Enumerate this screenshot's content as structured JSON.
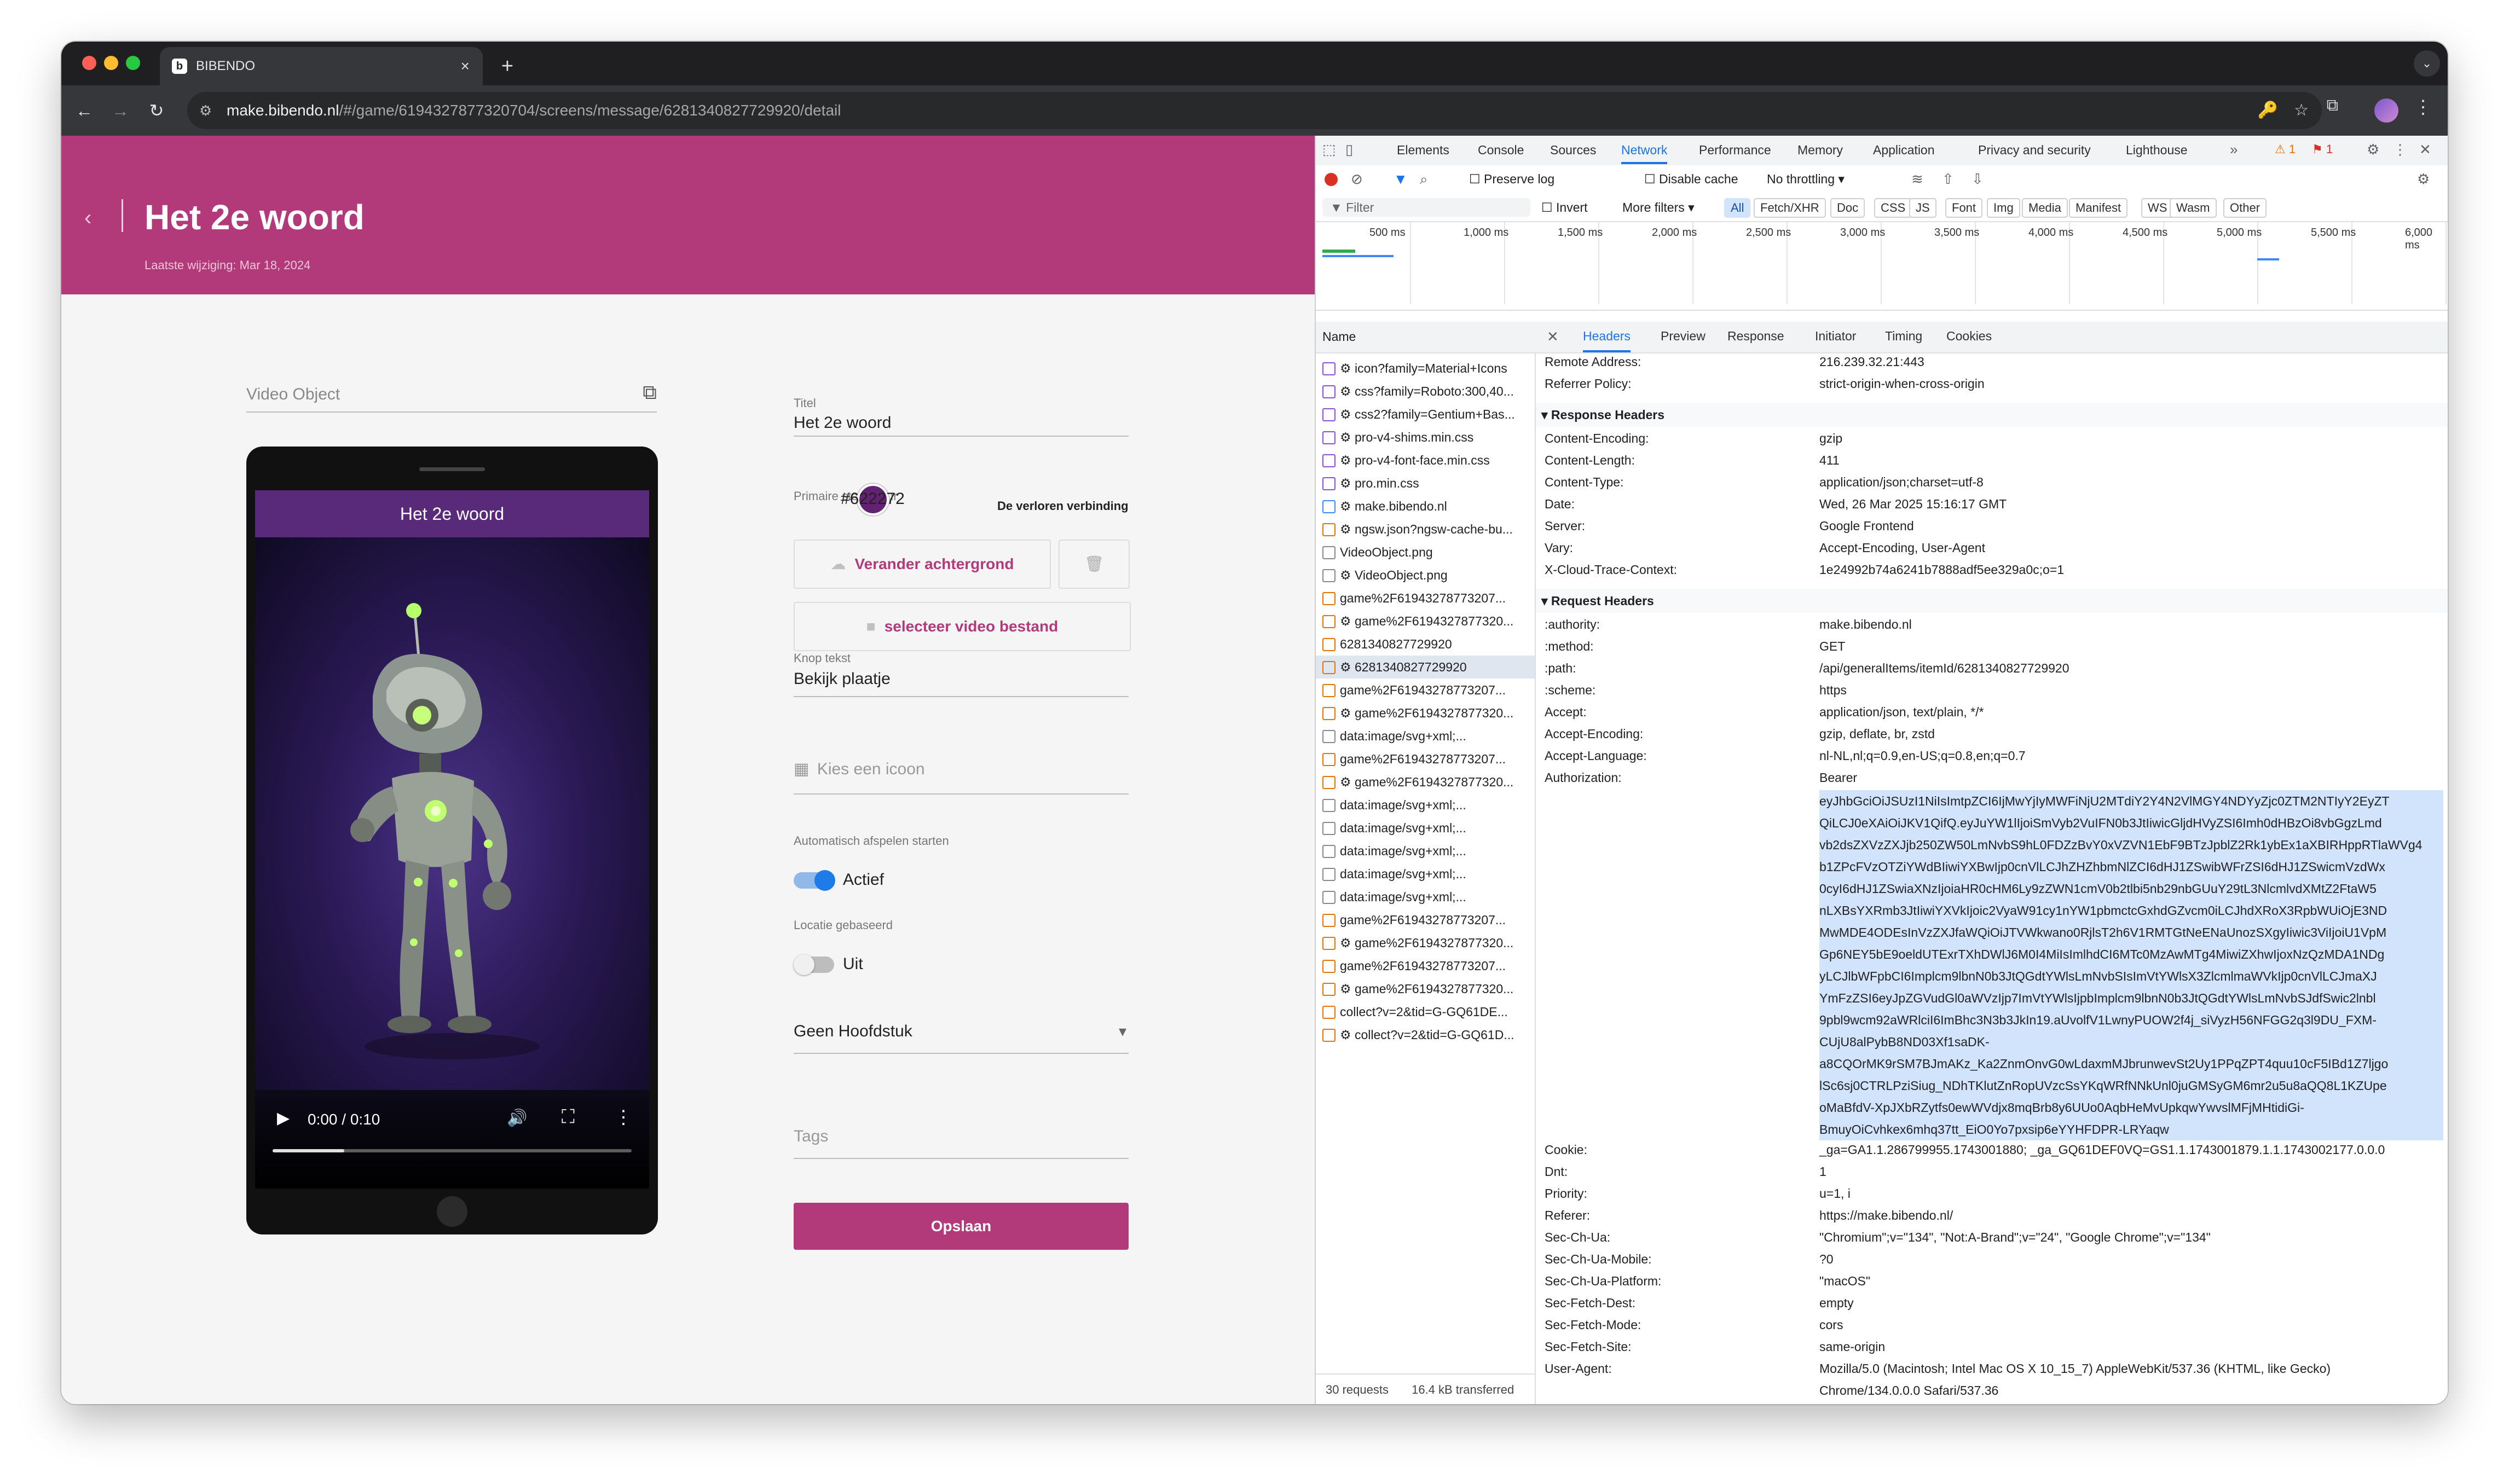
{
  "browser": {
    "tab_title": "BIBENDO",
    "tab_close": "×",
    "new_tab": "+",
    "tab_dropdown": "⌄",
    "url_host": "make.bibendo.nl",
    "url_path": "/#/game/6194327877320704/screens/message/6281340827729920/detail",
    "nav_back": "←",
    "nav_forward": "→",
    "nav_reload": "↻",
    "site_info": "⚙",
    "key_icon": "🔑",
    "bookmark_icon": "☆",
    "extensions_icon": "⧉",
    "menu": "⋮"
  },
  "app": {
    "back": "‹",
    "title": "Het 2e woord",
    "subtitle": "Laatste wijziging: Mar 18, 2024",
    "video_object_placeholder": "Video Object",
    "video_object_icon": "⧉",
    "preview_title": "Het 2e woord",
    "video_time": "0:00 / 0:10",
    "video_progress": 0.2,
    "play": "▶",
    "volume": "🔊",
    "fullscreen": "⛶",
    "more": "⋮",
    "titel_label": "Titel",
    "titel_value": "Het 2e woord",
    "color_label": "Primaire steunkleur",
    "color_value": "#622272",
    "color_hex": "#622272",
    "color_side_label": "De verloren verbinding",
    "change_bg_label": "Verander achtergrond",
    "cloud_icon": "☁",
    "trash_icon": "🗑",
    "video_select_label": "selecteer video bestand",
    "video_cam_icon": "■",
    "knop_label": "Knop tekst",
    "knop_value": "Bekijk plaatje",
    "icon_placeholder": "Kies een icoon",
    "icon_icon": "▦",
    "autoplay_label": "Automatisch afspelen starten",
    "autoplay_value": "Actief",
    "location_label": "Locatie gebaseerd",
    "location_value": "Uit",
    "chapter_value": "Geen Hoofdstuk",
    "chapter_caret": "▾",
    "tags_placeholder": "Tags",
    "save": "Opslaan",
    "brand_color": "#b23a7a"
  },
  "devtools": {
    "tabs": [
      "Elements",
      "Console",
      "Sources",
      "Network",
      "Performance",
      "Memory",
      "Application",
      "Privacy and security",
      "Lighthouse"
    ],
    "more_tabs": "»",
    "warnings": "⚠ 1",
    "errors": "⚑ 1",
    "preserve_log": "Preserve log",
    "disable_cache": "Disable cache",
    "throttling": "No throttling",
    "filter_placeholder": "Filter",
    "invert": "Invert",
    "more_filters": "More filters ▾",
    "filter_types": [
      "All",
      "Fetch/XHR",
      "Doc",
      "CSS",
      "JS",
      "Font",
      "Img",
      "Media",
      "Manifest",
      "WS",
      "Wasm",
      "Other"
    ],
    "timeline_labels": [
      "500 ms",
      "1,000 ms",
      "1,500 ms",
      "2,000 ms",
      "2,500 ms",
      "3,000 ms",
      "3,500 ms",
      "4,000 ms",
      "4,500 ms",
      "5,000 ms",
      "5,500 ms",
      "6,000 ms"
    ],
    "name_header": "Name",
    "detail_tabs": [
      "Headers",
      "Preview",
      "Response",
      "Initiator",
      "Timing",
      "Cookies"
    ],
    "close": "✕",
    "requests": [
      "⚙ icon?family=Material+Icons",
      "⚙ css?family=Roboto:300,40...",
      "⚙ css2?family=Gentium+Bas...",
      "⚙ pro-v4-shims.min.css",
      "⚙ pro-v4-font-face.min.css",
      "⚙ pro.min.css",
      "⚙ make.bibendo.nl",
      "⚙ ngsw.json?ngsw-cache-bu...",
      "VideoObject.png",
      "⚙ VideoObject.png",
      "game%2F61943278773207...",
      "⚙ game%2F6194327877320...",
      "6281340827729920",
      "⚙ 6281340827729920",
      "game%2F61943278773207...",
      "⚙ game%2F6194327877320...",
      "data:image/svg+xml;...",
      "game%2F61943278773207...",
      "⚙ game%2F6194327877320...",
      "data:image/svg+xml;...",
      "data:image/svg+xml;...",
      "data:image/svg+xml;...",
      "data:image/svg+xml;...",
      "data:image/svg+xml;...",
      "game%2F61943278773207...",
      "⚙ game%2F6194327877320...",
      "game%2F61943278773207...",
      "⚙ game%2F6194327877320...",
      "collect?v=2&tid=G-GQ61DE...",
      "⚙ collect?v=2&tid=G-GQ61D..."
    ],
    "status_requests": "30 requests",
    "status_transferred": "16.4 kB transferred",
    "general": [
      {
        "k": "Remote Address:",
        "v": "216.239.32.21:443"
      },
      {
        "k": "Referrer Policy:",
        "v": "strict-origin-when-cross-origin"
      }
    ],
    "response_title": "▾ Response Headers",
    "response_headers": [
      {
        "k": "Content-Encoding:",
        "v": "gzip"
      },
      {
        "k": "Content-Length:",
        "v": "411"
      },
      {
        "k": "Content-Type:",
        "v": "application/json;charset=utf-8"
      },
      {
        "k": "Date:",
        "v": "Wed, 26 Mar 2025 15:16:17 GMT"
      },
      {
        "k": "Server:",
        "v": "Google Frontend"
      },
      {
        "k": "Vary:",
        "v": "Accept-Encoding, User-Agent"
      },
      {
        "k": "X-Cloud-Trace-Context:",
        "v": "1e24992b74a6241b7888adf5ee329a0c;o=1"
      }
    ],
    "request_title": "▾ Request Headers",
    "request_headers": [
      {
        "k": ":authority:",
        "v": "make.bibendo.nl"
      },
      {
        "k": ":method:",
        "v": "GET"
      },
      {
        "k": ":path:",
        "v": "/api/generalItems/itemId/6281340827729920"
      },
      {
        "k": ":scheme:",
        "v": "https"
      },
      {
        "k": "Accept:",
        "v": "application/json, text/plain, */*"
      },
      {
        "k": "Accept-Encoding:",
        "v": "gzip, deflate, br, zstd"
      },
      {
        "k": "Accept-Language:",
        "v": "nl-NL,nl;q=0.9,en-US;q=0.8,en;q=0.7"
      },
      {
        "k": "Authorization:",
        "v": "Bearer"
      }
    ],
    "auth_lines": [
      "eyJhbGciOiJSUzI1NiIsImtpZCI6IjMwYjIyMWFiNjU2MTdiY2Y4N2VlMGY4NDYyZjc0ZTM2NTIyY2EyZT",
      "QiLCJ0eXAiOiJKV1QifQ.eyJuYW1lIjoiSmVyb2VuIFN0b3JtIiwicGljdHVyZSI6Imh0dHBzOi8vbGgzLmd",
      "vb2dsZXVzZXJjb250ZW50LmNvbS9hL0FDZzBvY0xVZVN1EbF9BTzJpblZ2Rk1ybEx1aXBIRHppRTlaWVg4",
      "b1ZPcFVzOTZiYWdBIiwiYXBwIjp0cnVlLCJhZHZhbmNlZCI6dHJ1ZSwibWFrZSI6dHJ1ZSwicmVzdWx",
      "0cyI6dHJ1ZSwiaXNzIjoiaHR0cHM6Ly9zZWN1cmV0b2tlbi5nb29nbGUuY29tL3NlcmlvdXMtZ2FtaW5",
      "nLXBsYXRmb3JtIiwiYXVkIjoic2VyaW91cy1nYW1pbmctcGxhdGZvcm0iLCJhdXRoX3RpbWUiOjE3ND",
      "MwMDE4ODEsInVzZXJfaWQiOiJTVWkwano0RjlsT2h6V1RMTGtNeENaUnozSXgyIiwic3ViIjoiU1VpM",
      "Gp6NEY5bE9oeldUTExrTXhDWlJ6M0I4MiIsImlhdCI6MTc0MzAwMTg4MiwiZXhwIjoxNzQzMDA1NDg",
      "yLCJlbWFpbCI6Implcm9lbnN0b3JtQGdtYWlsLmNvbSIsImVtYWlsX3ZlcmlmaWVkIjp0cnVlLCJmaXJ",
      "YmFzZSI6eyJpZGVudGl0aWVzIjp7ImVtYWlsIjpbImplcm9lbnN0b3JtQGdtYWlsLmNvbSJdfSwic2lnbl",
      "9pbl9wcm92aWRlciI6ImBhc3N3b3JkIn19.aUvolfV1LwnyPUOW2f4j_siVyzH56NFGG2q3l9DU_FXM-",
      "CUjU8alPybB8ND03Xf1saDK-",
      "a8CQOrMK9rSM7BJmAKz_Ka2ZnmOnvG0wLdaxmMJbrunwevSt2Uy1PPqZPT4quu10cF5IBd1Z7ljgo",
      "lSc6sj0CTRLPziSiug_NDhTKlutZnRopUVzcSsYKqWRfNNkUnl0juGMSyGM6mr2u5u8aQQ8L1KZUpe",
      "oMaBfdV-XpJXbRZytfs0ewWVdjx8mqBrb8y6UUo0AqbHeMvUpkqwYwvslMFjMHtidiGi-",
      "BmuyOiCvhkex6mhq37tt_EiO0Yo7pxsip6eYYHFDPR-LRYaqw"
    ],
    "request_headers_2": [
      {
        "k": "Cookie:",
        "v": "_ga=GA1.1.286799955.1743001880; _ga_GQ61DEF0VQ=GS1.1.1743001879.1.1.1743002177.0.0.0"
      },
      {
        "k": "Dnt:",
        "v": "1"
      },
      {
        "k": "Priority:",
        "v": "u=1, i"
      },
      {
        "k": "Referer:",
        "v": "https://make.bibendo.nl/"
      },
      {
        "k": "Sec-Ch-Ua:",
        "v": "\"Chromium\";v=\"134\", \"Not:A-Brand\";v=\"24\", \"Google Chrome\";v=\"134\""
      },
      {
        "k": "Sec-Ch-Ua-Mobile:",
        "v": "?0"
      },
      {
        "k": "Sec-Ch-Ua-Platform:",
        "v": "\"macOS\""
      },
      {
        "k": "Sec-Fetch-Dest:",
        "v": "empty"
      },
      {
        "k": "Sec-Fetch-Mode:",
        "v": "cors"
      },
      {
        "k": "Sec-Fetch-Site:",
        "v": "same-origin"
      },
      {
        "k": "User-Agent:",
        "v": "Mozilla/5.0 (Macintosh; Intel Mac OS X 10_15_7) AppleWebKit/537.36 (KHTML, like Gecko)"
      },
      {
        "k": "",
        "v": "Chrome/134.0.0.0 Safari/537.36"
      }
    ]
  }
}
